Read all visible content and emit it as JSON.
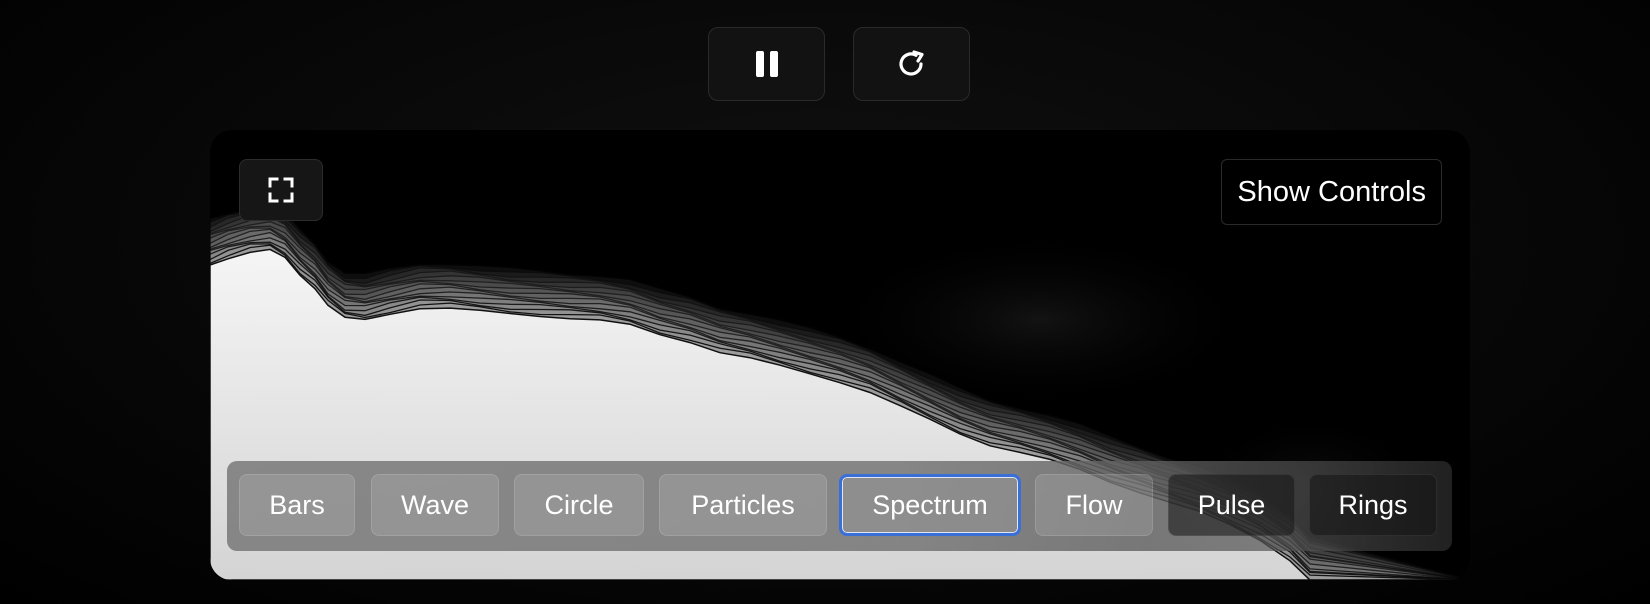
{
  "controls": {
    "pause": {
      "icon": "pause-icon"
    },
    "reset": {
      "icon": "refresh-icon"
    }
  },
  "panel": {
    "fullscreen_icon": "fullscreen-icon",
    "show_controls_label": "Show Controls"
  },
  "modes": [
    {
      "label": "Bars"
    },
    {
      "label": "Wave"
    },
    {
      "label": "Circle"
    },
    {
      "label": "Particles"
    },
    {
      "label": "Spectrum",
      "active": true
    },
    {
      "label": "Flow"
    },
    {
      "label": "Pulse"
    },
    {
      "label": "Rings"
    }
  ],
  "colors": {
    "active_outline": "#3b6fd8",
    "panel_fill": "#efefef"
  }
}
